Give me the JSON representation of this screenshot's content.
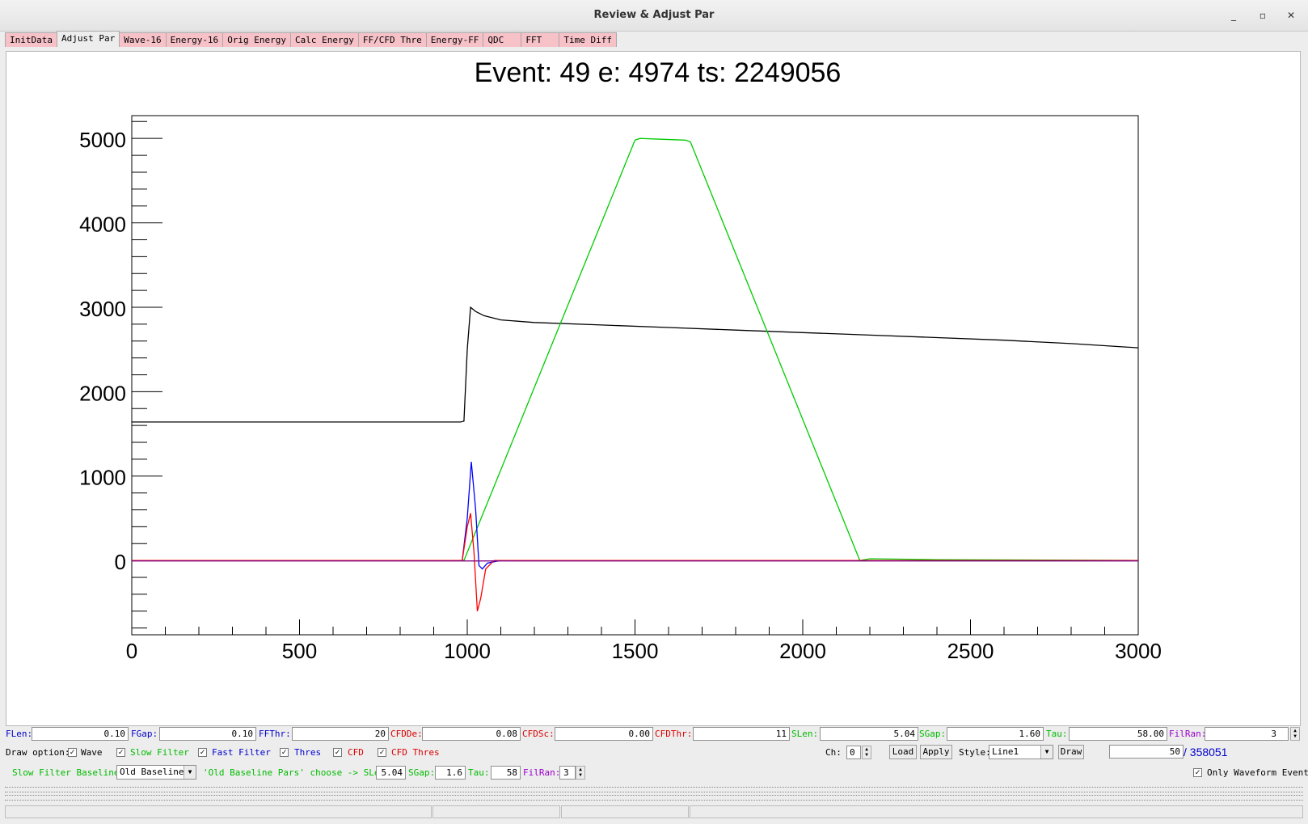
{
  "window": {
    "title": "Review & Adjust Par",
    "controls": [
      "_",
      "▫",
      "✕"
    ]
  },
  "tabs": [
    {
      "label": "InitData",
      "active": false
    },
    {
      "label": "Adjust Par",
      "active": true
    },
    {
      "label": "Wave-16",
      "active": false
    },
    {
      "label": "Energy-16",
      "active": false
    },
    {
      "label": "Orig Energy",
      "active": false
    },
    {
      "label": "Calc Energy",
      "active": false
    },
    {
      "label": "FF/CFD Thre",
      "active": false
    },
    {
      "label": "Energy-FF",
      "active": false
    },
    {
      "label": "QDC",
      "active": false
    },
    {
      "label": "FFT",
      "active": false
    },
    {
      "label": "Time Diff",
      "active": false
    }
  ],
  "plot": {
    "title": "Event: 49   e: 4974   ts: 2249056"
  },
  "chart_data": {
    "type": "line",
    "title": "Event: 49   e: 4974   ts: 2249056",
    "xlabel": "",
    "ylabel": "",
    "xlim": [
      0,
      3000
    ],
    "ylim": [
      -880,
      5270
    ],
    "x_ticks": [
      "0",
      "500",
      "1000",
      "1500",
      "2000",
      "2500",
      "3000"
    ],
    "y_ticks": [
      "0",
      "1000",
      "2000",
      "3000",
      "4000",
      "5000"
    ],
    "grid": false,
    "series": [
      {
        "color": "#000000",
        "x": [
          0,
          980,
          990,
          1000,
          1010,
          1025,
          1050,
          1100,
          1200,
          1400,
          1600,
          1800,
          2000,
          2200,
          2400,
          2600,
          2800,
          3000
        ],
        "y": [
          1640,
          1640,
          1650,
          2500,
          3000,
          2950,
          2900,
          2850,
          2820,
          2790,
          2760,
          2730,
          2700,
          2670,
          2640,
          2610,
          2570,
          2520
        ]
      },
      {
        "color": "#00cc00",
        "x": [
          0,
          990,
          1500,
          1515,
          1650,
          1665,
          2170,
          2200,
          2400,
          3000
        ],
        "y": [
          0,
          0,
          4980,
          5000,
          4980,
          4960,
          0,
          20,
          10,
          0
        ]
      },
      {
        "color": "#0000ff",
        "x": [
          0,
          985,
          1000,
          1012,
          1025,
          1035,
          1045,
          1060,
          1100,
          3000
        ],
        "y": [
          0,
          0,
          500,
          1170,
          600,
          -60,
          -100,
          -30,
          0,
          0
        ]
      },
      {
        "color": "#ff0000",
        "x": [
          0,
          985,
          1000,
          1010,
          1020,
          1030,
          1040,
          1055,
          1080,
          3000
        ],
        "y": [
          0,
          0,
          400,
          560,
          100,
          -600,
          -450,
          -100,
          0,
          0
        ]
      },
      {
        "color": "#800080",
        "x": [
          0,
          3000
        ],
        "y": [
          -5,
          -5
        ]
      }
    ]
  },
  "params": {
    "flen": {
      "label": "FLen:",
      "value": "0.10",
      "color": "#0000cc"
    },
    "fgap": {
      "label": "FGap:",
      "value": "0.10",
      "color": "#0000cc"
    },
    "ffthr": {
      "label": "FFThr:",
      "value": "20",
      "color": "#0000cc"
    },
    "cfdde": {
      "label": "CFDDe:",
      "value": "0.08",
      "color": "#dd0000"
    },
    "cfdsc": {
      "label": "CFDSc:",
      "value": "0.00",
      "color": "#dd0000"
    },
    "cfdthr": {
      "label": "CFDThr:",
      "value": "11",
      "color": "#dd0000"
    },
    "slen": {
      "label": "SLen:",
      "value": "5.04",
      "color": "#00bb00"
    },
    "sgap": {
      "label": "SGap:",
      "value": "1.60",
      "color": "#00bb00"
    },
    "tau": {
      "label": "Tau:",
      "value": "58.00",
      "color": "#00bb00"
    },
    "filran": {
      "label": "FilRan:",
      "value": "3",
      "color": "#9900cc"
    }
  },
  "draw_options": {
    "label": "Draw option:",
    "items": [
      {
        "label": "Wave",
        "checked": true,
        "color": "#000000"
      },
      {
        "label": "Slow Filter",
        "checked": true,
        "color": "#00bb00"
      },
      {
        "label": "Fast Filter",
        "checked": true,
        "color": "#0000cc"
      },
      {
        "label": "Thres",
        "checked": true,
        "color": "#0000cc"
      },
      {
        "label": "CFD",
        "checked": true,
        "color": "#dd0000"
      },
      {
        "label": "CFD Thres",
        "checked": true,
        "color": "#dd0000"
      }
    ]
  },
  "controls": {
    "ch_label": "Ch:",
    "ch_value": "0",
    "load": "Load",
    "apply": "Apply",
    "style_label": "Style:",
    "style_value": "Line1",
    "draw": "Draw",
    "event_value": "50",
    "event_total": "/ 358051"
  },
  "baseline": {
    "label": "Slow Filter Baseline:",
    "mode": "Old Baseline",
    "choose_text": "'Old Baseline Pars' choose -> SLen:",
    "slen": "5.04",
    "sgap_label": "SGap:",
    "sgap": "1.6",
    "tau_label": "Tau:",
    "tau": "58",
    "filran_label": "FilRan:",
    "filran": "3",
    "only_waveform_label": "Only Waveform Event",
    "only_waveform_checked": true
  }
}
